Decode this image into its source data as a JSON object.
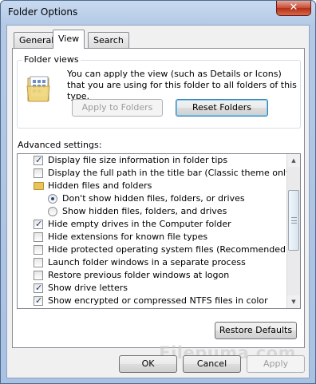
{
  "window": {
    "title": "Folder Options",
    "close_glyph": "✕"
  },
  "tabs": [
    {
      "label": "General",
      "active": false
    },
    {
      "label": "View",
      "active": true
    },
    {
      "label": "Search",
      "active": false
    }
  ],
  "folder_views": {
    "title": "Folder views",
    "icon": "folder-views-icon",
    "description": "You can apply the view (such as Details or Icons) that you are using for this folder to all folders of this type.",
    "apply_button": "Apply to Folders",
    "reset_button": "Reset Folders"
  },
  "advanced": {
    "label": "Advanced settings:",
    "items": [
      {
        "type": "checkbox",
        "checked": true,
        "label": "Display file size information in folder tips"
      },
      {
        "type": "checkbox",
        "checked": false,
        "label": "Display the full path in the title bar (Classic theme only)"
      },
      {
        "type": "folder",
        "label": "Hidden files and folders"
      },
      {
        "type": "radio",
        "checked": true,
        "label": "Don't show hidden files, folders, or drives"
      },
      {
        "type": "radio",
        "checked": false,
        "label": "Show hidden files, folders, and drives"
      },
      {
        "type": "checkbox",
        "checked": true,
        "label": "Hide empty drives in the Computer folder"
      },
      {
        "type": "checkbox",
        "checked": false,
        "label": "Hide extensions for known file types"
      },
      {
        "type": "checkbox",
        "checked": false,
        "label": "Hide protected operating system files (Recommended)"
      },
      {
        "type": "checkbox",
        "checked": false,
        "label": "Launch folder windows in a separate process"
      },
      {
        "type": "checkbox",
        "checked": false,
        "label": "Restore previous folder windows at logon"
      },
      {
        "type": "checkbox",
        "checked": true,
        "label": "Show drive letters"
      },
      {
        "type": "checkbox",
        "checked": true,
        "label": "Show encrypted or compressed NTFS files in color"
      }
    ],
    "restore_button": "Restore Defaults"
  },
  "footer": {
    "ok": "OK",
    "cancel": "Cancel",
    "apply": "Apply"
  },
  "watermark": "Filepuma.com"
}
